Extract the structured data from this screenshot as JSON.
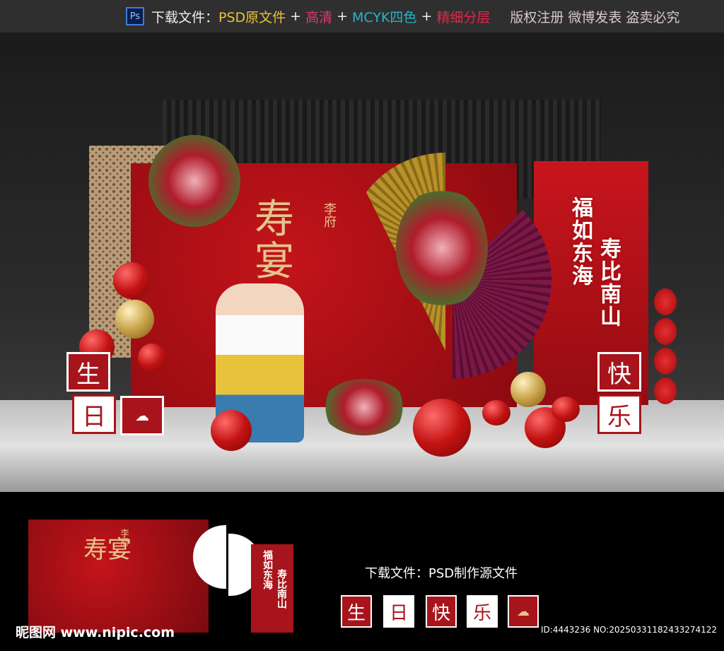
{
  "top_bar": {
    "download_label": "下载文件：",
    "psd": "PSD原文件",
    "plus": "+",
    "hd": "高清",
    "mcyk": "MCYK四色",
    "layers": "精细分层",
    "copyright": "版权注册 微博发表 盗卖必究",
    "ps_icon": "Ps",
    "colors": {
      "psd": "#e8c33a",
      "hd": "#e0396a",
      "mcyk": "#27b4c8",
      "layers": "#e8254a",
      "copyright": "#d8c8c8"
    }
  },
  "backdrop": {
    "title": "寿宴",
    "family": "李府",
    "couplet_left": "福如东海",
    "couplet_right": "寿比南山",
    "cubes": [
      "生",
      "日",
      "快",
      "乐"
    ]
  },
  "preview": {
    "title": "寿宴",
    "family": "李府",
    "couplet_left": "福如东海",
    "couplet_right": "寿比南山",
    "download_text": "下载文件：PSD制作源文件",
    "tiles": [
      "生",
      "日",
      "快",
      "乐"
    ]
  },
  "watermark": {
    "logo": "昵图网 www.nipic.com",
    "id": "ID:4443236 NO:20250331182433274122"
  }
}
